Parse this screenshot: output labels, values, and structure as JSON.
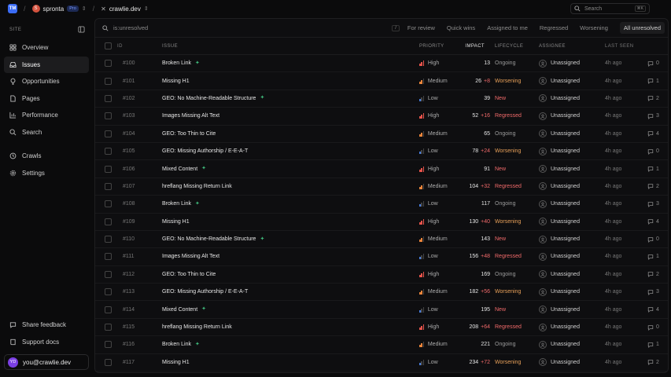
{
  "topbar": {
    "logo_text": "TM",
    "org_initial": "S",
    "org_name": "spronta",
    "plan_badge": "Pro",
    "site_name": "crawlie.dev",
    "search_placeholder": "Search",
    "search_shortcut": "⌘K"
  },
  "sidebar": {
    "section_label": "SITE",
    "items": [
      {
        "label": "Overview",
        "icon": "grid-icon"
      },
      {
        "label": "Issues",
        "icon": "inbox-icon",
        "active": true
      },
      {
        "label": "Opportunities",
        "icon": "lightbulb-icon"
      },
      {
        "label": "Pages",
        "icon": "pages-icon"
      },
      {
        "label": "Performance",
        "icon": "chart-icon"
      },
      {
        "label": "Search",
        "icon": "search-icon"
      }
    ],
    "items2": [
      {
        "label": "Crawls",
        "icon": "history-icon"
      },
      {
        "label": "Settings",
        "icon": "gear-icon"
      }
    ],
    "bottom": [
      {
        "label": "Share feedback",
        "icon": "chat-icon"
      },
      {
        "label": "Support docs",
        "icon": "book-icon"
      }
    ],
    "user": {
      "initials": "YD",
      "email": "you@crawlie.dev"
    }
  },
  "filter": {
    "query": "is:unresolved",
    "shortcut": "/",
    "tabs": [
      "For review",
      "Quick wins",
      "Assigned to me",
      "Regressed",
      "Worsening",
      "All unresolved"
    ],
    "active_tab": "All unresolved"
  },
  "table": {
    "headers": {
      "id": "ID",
      "issue": "ISSUE",
      "priority": "PRIORITY",
      "impact": "IMPACT",
      "lifecycle": "LIFECYCLE",
      "assignee": "ASSIGNEE",
      "last_seen": "LAST SEEN"
    },
    "rows": [
      {
        "id": "#100",
        "issue": "Broken Link",
        "icon": true,
        "priority": "High",
        "impact": "13",
        "delta": "",
        "lifecycle": "Ongoing",
        "assignee": "Unassigned",
        "seen": "4h ago",
        "comments": "0"
      },
      {
        "id": "#101",
        "issue": "Missing H1",
        "icon": false,
        "priority": "Medium",
        "impact": "26",
        "delta": "+8",
        "lifecycle": "Worsening",
        "assignee": "Unassigned",
        "seen": "4h ago",
        "comments": "1"
      },
      {
        "id": "#102",
        "issue": "GEO: No Machine-Readable Structure",
        "icon": true,
        "priority": "Low",
        "impact": "39",
        "delta": "",
        "lifecycle": "New",
        "assignee": "Unassigned",
        "seen": "4h ago",
        "comments": "2"
      },
      {
        "id": "#103",
        "issue": "Images Missing Alt Text",
        "icon": false,
        "priority": "High",
        "impact": "52",
        "delta": "+16",
        "lifecycle": "Regressed",
        "assignee": "Unassigned",
        "seen": "4h ago",
        "comments": "3"
      },
      {
        "id": "#104",
        "issue": "GEO: Too Thin to Cite",
        "icon": false,
        "priority": "Medium",
        "impact": "65",
        "delta": "",
        "lifecycle": "Ongoing",
        "assignee": "Unassigned",
        "seen": "4h ago",
        "comments": "4"
      },
      {
        "id": "#105",
        "issue": "GEO: Missing Authorship / E-E-A-T",
        "icon": false,
        "priority": "Low",
        "impact": "78",
        "delta": "+24",
        "lifecycle": "Worsening",
        "assignee": "Unassigned",
        "seen": "4h ago",
        "comments": "0"
      },
      {
        "id": "#106",
        "issue": "Mixed Content",
        "icon": true,
        "priority": "High",
        "impact": "91",
        "delta": "",
        "lifecycle": "New",
        "assignee": "Unassigned",
        "seen": "4h ago",
        "comments": "1"
      },
      {
        "id": "#107",
        "issue": "hreflang Missing Return Link",
        "icon": false,
        "priority": "Medium",
        "impact": "104",
        "delta": "+32",
        "lifecycle": "Regressed",
        "assignee": "Unassigned",
        "seen": "4h ago",
        "comments": "2"
      },
      {
        "id": "#108",
        "issue": "Broken Link",
        "icon": true,
        "priority": "Low",
        "impact": "117",
        "delta": "",
        "lifecycle": "Ongoing",
        "assignee": "Unassigned",
        "seen": "4h ago",
        "comments": "3"
      },
      {
        "id": "#109",
        "issue": "Missing H1",
        "icon": false,
        "priority": "High",
        "impact": "130",
        "delta": "+40",
        "lifecycle": "Worsening",
        "assignee": "Unassigned",
        "seen": "4h ago",
        "comments": "4"
      },
      {
        "id": "#110",
        "issue": "GEO: No Machine-Readable Structure",
        "icon": true,
        "priority": "Medium",
        "impact": "143",
        "delta": "",
        "lifecycle": "New",
        "assignee": "Unassigned",
        "seen": "4h ago",
        "comments": "0"
      },
      {
        "id": "#111",
        "issue": "Images Missing Alt Text",
        "icon": false,
        "priority": "Low",
        "impact": "156",
        "delta": "+48",
        "lifecycle": "Regressed",
        "assignee": "Unassigned",
        "seen": "4h ago",
        "comments": "1"
      },
      {
        "id": "#112",
        "issue": "GEO: Too Thin to Cite",
        "icon": false,
        "priority": "High",
        "impact": "169",
        "delta": "",
        "lifecycle": "Ongoing",
        "assignee": "Unassigned",
        "seen": "4h ago",
        "comments": "2"
      },
      {
        "id": "#113",
        "issue": "GEO: Missing Authorship / E-E-A-T",
        "icon": false,
        "priority": "Medium",
        "impact": "182",
        "delta": "+56",
        "lifecycle": "Worsening",
        "assignee": "Unassigned",
        "seen": "4h ago",
        "comments": "3"
      },
      {
        "id": "#114",
        "issue": "Mixed Content",
        "icon": true,
        "priority": "Low",
        "impact": "195",
        "delta": "",
        "lifecycle": "New",
        "assignee": "Unassigned",
        "seen": "4h ago",
        "comments": "4"
      },
      {
        "id": "#115",
        "issue": "hreflang Missing Return Link",
        "icon": false,
        "priority": "High",
        "impact": "208",
        "delta": "+64",
        "lifecycle": "Regressed",
        "assignee": "Unassigned",
        "seen": "4h ago",
        "comments": "0"
      },
      {
        "id": "#116",
        "issue": "Broken Link",
        "icon": true,
        "priority": "Medium",
        "impact": "221",
        "delta": "",
        "lifecycle": "Ongoing",
        "assignee": "Unassigned",
        "seen": "4h ago",
        "comments": "1"
      },
      {
        "id": "#117",
        "issue": "Missing H1",
        "icon": false,
        "priority": "Low",
        "impact": "234",
        "delta": "+72",
        "lifecycle": "Worsening",
        "assignee": "Unassigned",
        "seen": "4h ago",
        "comments": "2"
      }
    ]
  },
  "colors": {
    "high": "#e5534b",
    "medium": "#e8843b",
    "low": "#4a7fe0",
    "worsening": "#e8a15a",
    "new": "#f06a6a",
    "regressed": "#f06a6a",
    "ongoing": "#9a9a9a",
    "delta": "#f06a6a"
  }
}
